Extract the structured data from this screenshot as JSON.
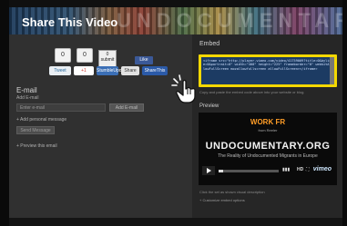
{
  "dialog": {
    "title": "Share This Video",
    "banner_text": "UNDOCUMENTARY"
  },
  "social": {
    "counters": [
      "0",
      "0"
    ],
    "badge_label": "submit",
    "badge_count": "0",
    "like_label": "Like",
    "buttons": [
      {
        "label": "Tweet",
        "color": "#e9eef3",
        "text_color": "#2a6b9e"
      },
      {
        "label": "+1",
        "color": "#ffffff",
        "text_color": "#cc3b2e"
      },
      {
        "label": "StumbleUpon",
        "color": "#3b6fb6",
        "text_color": "#ffffff"
      },
      {
        "label": "Share",
        "color": "#e2e2e2",
        "text_color": "#333333"
      },
      {
        "label": "ShareThis",
        "color": "#2b5aa8",
        "text_color": "#ffffff"
      }
    ]
  },
  "email": {
    "heading": "E-mail",
    "add_label": "Add E-mail",
    "input_placeholder": "Enter e-mail",
    "add_button": "Add E-mail",
    "personal_message_link": "+ Add personal message",
    "send_button": "Send Message",
    "preview_link": "+ Preview this email"
  },
  "embed": {
    "heading": "Embed",
    "code": "<iframe src=\"http://player.vimeo.com/video/41759009?title=0&byline=0&portrait=0\" width=\"400\" height=\"225\" frameborder=\"0\" webkitAllowFullScreen mozallowfullscreen allowFullScreen></iframe>",
    "highlight_color": "#f4d800",
    "note": "Copy and paste the embed code above into your website or blog.",
    "preview_heading": "Preview"
  },
  "player": {
    "title": "WORK FR",
    "from_line": "from Reeler",
    "site_name": "UNDOCUMENTARY.ORG",
    "subtitle": "The Reality of Undocumented Migrants in Europe",
    "progress_fraction": 0.08,
    "hd_label": "HD",
    "brand": "vimeo",
    "accent_color": "#ff9d27",
    "caption": "Click the set as shown visual description",
    "customize_link": "+ Customize embed options"
  },
  "cursor": {
    "icon": "pointer-hand-icon"
  }
}
